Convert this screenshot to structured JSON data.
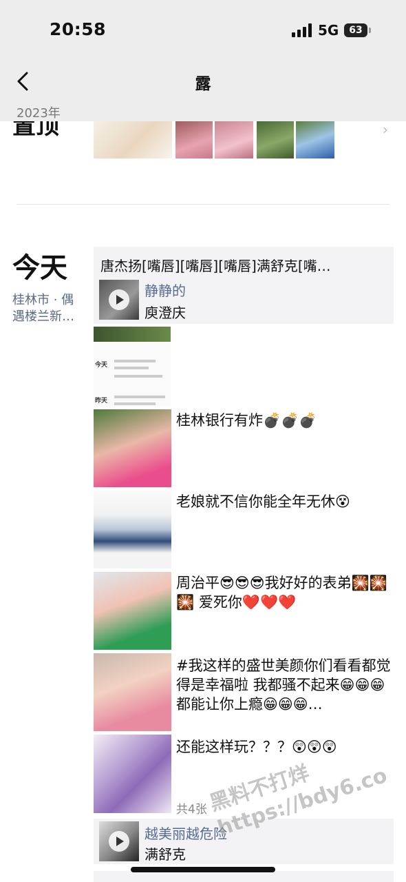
{
  "status_bar": {
    "time": "20:58",
    "network": "5G",
    "battery": "63"
  },
  "nav": {
    "title": "露"
  },
  "year": "2023年",
  "pinned": {
    "label": "置顶"
  },
  "day": {
    "label": "今天",
    "location": "桂林市 · 偶遇楼兰新…"
  },
  "share_card": {
    "text": "唐杰扬[嘴唇][嘴唇][嘴唇]满舒克[嘴…",
    "author": "静静的",
    "subtitle": "庾澄庆"
  },
  "screenshot_thumb": {
    "today": "今天",
    "yesterday": "昨天"
  },
  "posts": [
    {
      "text": "桂林银行有炸💣💣💣"
    },
    {
      "text": "老娘就不信你能全年无休😵"
    },
    {
      "text": "周治平😎😎😎我好好的表弟🎇🎇🎇 爱死你❤️❤️❤️"
    },
    {
      "text": "#我这样的盛世美颜你们看看都觉得是幸福啦 我都骚不起来😁😁😁 都能让你上瘾😁😁😁…"
    },
    {
      "text": "还能这样玩？？？😲😲😲"
    }
  ],
  "photo_count": "共4张",
  "share_card2": {
    "author": "越美丽越危险",
    "subtitle": "满舒克"
  },
  "watermark": {
    "line1": "黑料不打烊",
    "line2": "https://bdy6.co"
  }
}
